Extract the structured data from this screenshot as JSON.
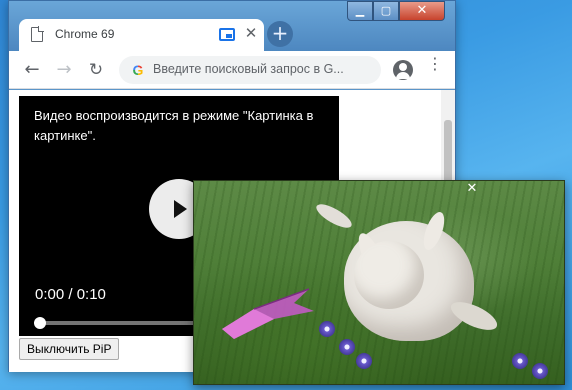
{
  "browser": {
    "tab_title": "Chrome 69",
    "tab_close_glyph": "✕",
    "new_tab_glyph": "+",
    "window_controls": {
      "minimize": "▁",
      "maximize": "▢",
      "close": "✕"
    },
    "nav": {
      "back": "←",
      "forward": "→",
      "reload": "↻"
    },
    "omnibox": {
      "placeholder": "Введите поисковый запрос в G...",
      "search_engine_icon": "google-g-icon"
    },
    "menu_glyph": "⋮",
    "icons": [
      "document-icon",
      "picture-in-picture-icon",
      "profile-icon",
      "menu-dots-icon"
    ]
  },
  "page": {
    "video": {
      "pip_message": "Видео воспроизводится в режиме \"Картинка в картинке\".",
      "time_display": "0:00 / 0:10",
      "progress_fraction": 0.0
    },
    "exit_pip_button": "Выключить PiP"
  },
  "pip_window": {
    "close_glyph": "✕"
  },
  "colors": {
    "accent_blue": "#1a73e8",
    "desktop": "#3a9be3"
  }
}
